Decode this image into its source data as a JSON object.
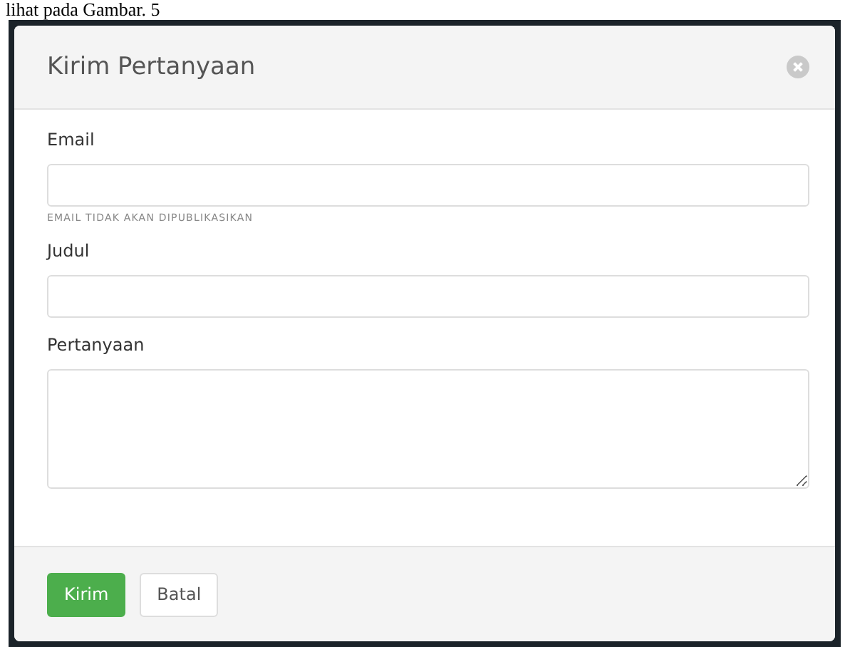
{
  "page_text": "lihat pada Gambar. 5",
  "dialog": {
    "title": "Kirim Pertanyaan",
    "fields": [
      {
        "label": "Email",
        "kind": "input",
        "hint": "EMAIL TIDAK AKAN DIPUBLIKASIKAN"
      },
      {
        "label": "Judul",
        "kind": "input"
      },
      {
        "label": "Pertanyaan",
        "kind": "textarea"
      }
    ],
    "buttons": [
      {
        "label": "Kirim",
        "kind": "primary"
      },
      {
        "label": "Batal",
        "kind": "default"
      }
    ]
  }
}
